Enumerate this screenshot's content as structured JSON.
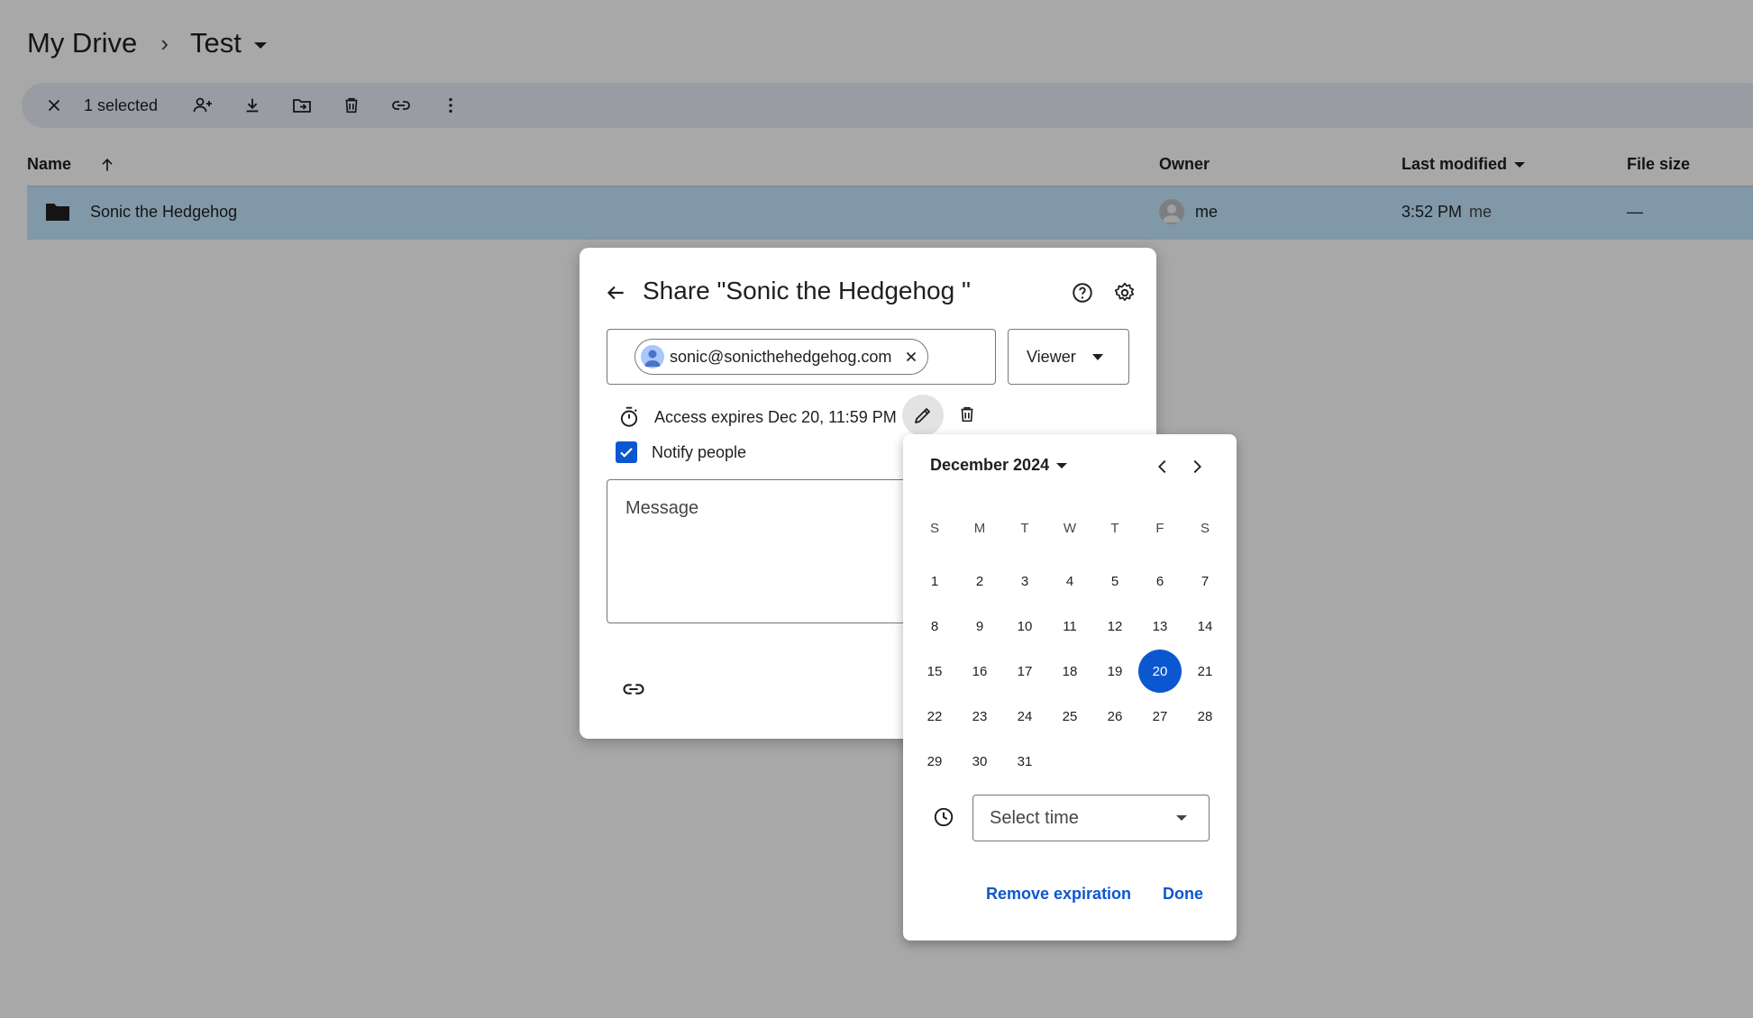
{
  "breadcrumb": {
    "root": "My Drive",
    "separator": "›",
    "current": "Test"
  },
  "toolbar": {
    "selected_count": "1 selected"
  },
  "list": {
    "columns": {
      "name": "Name",
      "owner": "Owner",
      "last_modified": "Last modified",
      "file_size": "File size"
    },
    "rows": [
      {
        "name": "Sonic the Hedgehog",
        "owner": "me",
        "modified_time": "3:52 PM",
        "modified_by": "me",
        "size": "—"
      }
    ]
  },
  "dialog": {
    "title": "Share \"Sonic the Hedgehog \"",
    "recipient_email": "sonic@sonicthehedgehog.com",
    "role": "Viewer",
    "access_expires": "Access expires Dec 20, 11:59 PM",
    "notify_label": "Notify people",
    "notify_checked": true,
    "message_placeholder": "Message"
  },
  "date_picker": {
    "month_label": "December 2024",
    "weekdays": [
      "S",
      "M",
      "T",
      "W",
      "T",
      "F",
      "S"
    ],
    "weeks": [
      [
        "1",
        "2",
        "3",
        "4",
        "5",
        "6",
        "7"
      ],
      [
        "8",
        "9",
        "10",
        "11",
        "12",
        "13",
        "14"
      ],
      [
        "15",
        "16",
        "17",
        "18",
        "19",
        "20",
        "21"
      ],
      [
        "22",
        "23",
        "24",
        "25",
        "26",
        "27",
        "28"
      ],
      [
        "29",
        "30",
        "31",
        "",
        "",
        "",
        ""
      ]
    ],
    "selected_day": "20",
    "time_placeholder": "Select time",
    "remove_label": "Remove expiration",
    "done_label": "Done"
  },
  "colors": {
    "accent": "#0b57d0",
    "selected_row": "#c2e7ff",
    "toolbar_bg": "#e8eef7"
  }
}
